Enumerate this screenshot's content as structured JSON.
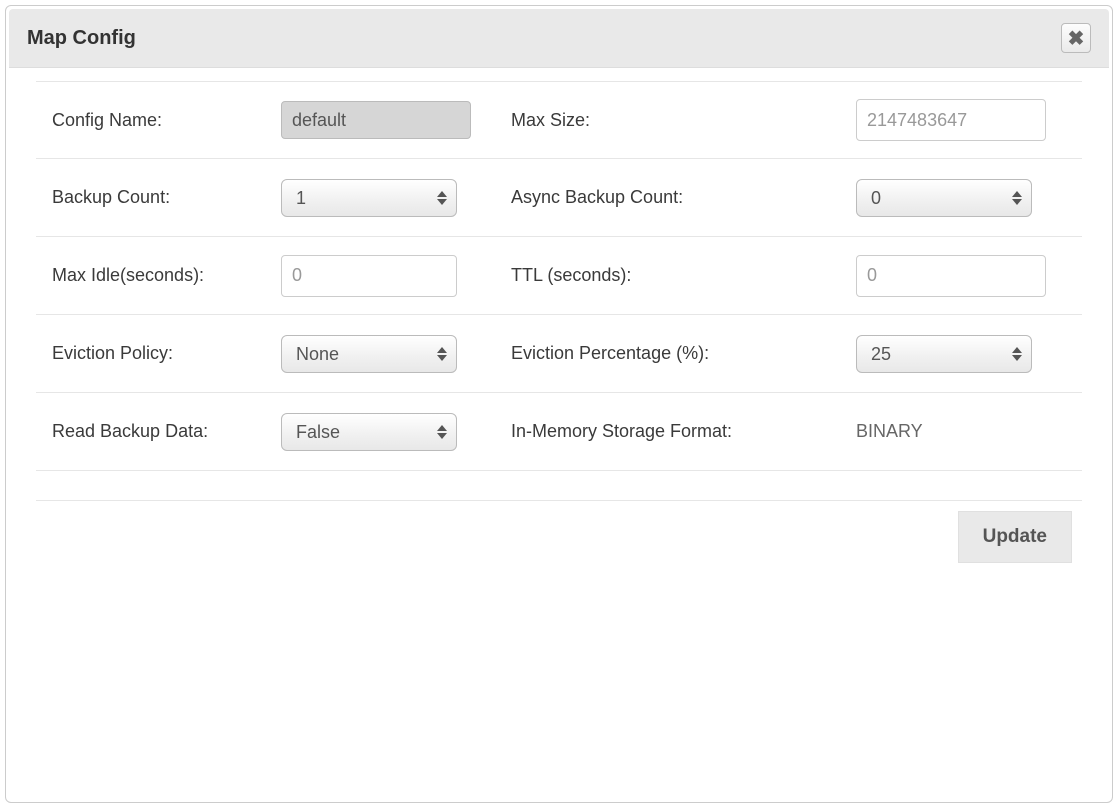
{
  "dialog": {
    "title": "Map Config"
  },
  "form": {
    "configName": {
      "label": "Config Name:",
      "value": "default"
    },
    "maxSize": {
      "label": "Max Size:",
      "placeholder": "2147483647",
      "value": ""
    },
    "backupCount": {
      "label": "Backup Count:",
      "value": "1"
    },
    "asyncBackupCount": {
      "label": "Async Backup Count:",
      "value": "0"
    },
    "maxIdle": {
      "label": "Max Idle(seconds):",
      "placeholder": "0",
      "value": ""
    },
    "ttl": {
      "label": "TTL (seconds):",
      "placeholder": "0",
      "value": ""
    },
    "evictionPolicy": {
      "label": "Eviction Policy:",
      "value": "None"
    },
    "evictionPercentage": {
      "label": "Eviction Percentage (%):",
      "value": "25"
    },
    "readBackupData": {
      "label": "Read Backup Data:",
      "value": "False"
    },
    "inMemoryFormat": {
      "label": "In-Memory Storage Format:",
      "value": "BINARY"
    }
  },
  "buttons": {
    "update": "Update"
  }
}
